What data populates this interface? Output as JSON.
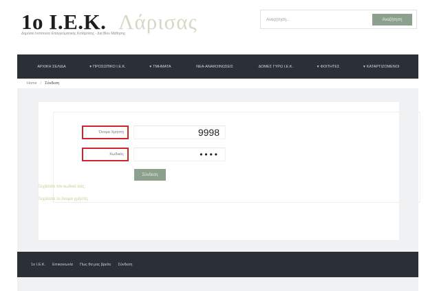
{
  "header": {
    "logo_main": "1ο Ι.Ε.Κ.",
    "logo_accent": "Λάρισας",
    "tagline": "Δημόσιο Ινστιτούτο Επαγγελματικής Κατάρτισης - Δια Βίου Μάθησης"
  },
  "search": {
    "placeholder": "Αναζήτηση...",
    "button_label": "Αναζήτηση"
  },
  "nav": {
    "items": [
      {
        "label": "ΑΡΧΙΚΗ ΣΕΛΙΔΑ",
        "arrow": ""
      },
      {
        "label": "ΠΡΟΣΩΠΙΚΟ Ι.Ε.Κ.",
        "arrow": "▾"
      },
      {
        "label": "ΤΜΗΜΑΤΑ",
        "arrow": "▾"
      },
      {
        "label": "ΝΕΑ-ΑΝΑΚΟΙΝΩΣΕΙΣ",
        "arrow": ""
      },
      {
        "label": "ΔΟΜΕΣ ΓΥΡΩ Ι.Ε.Κ.",
        "arrow": ""
      },
      {
        "label": "ΦΟΙΤΗΤΕΣ",
        "arrow": "▾"
      },
      {
        "label": "ΚΑΤΑΡΤΙΖΟΜΕΝΟΙ",
        "arrow": "▾"
      }
    ]
  },
  "breadcrumb": {
    "home": "Home",
    "separator": "/",
    "current": "Σύνδεση"
  },
  "login_form": {
    "username_label": "Όνομα Χρήστη",
    "username_value": "9998",
    "password_label": "Κωδικός",
    "password_mask": "••••",
    "submit_label": "Σύνδεση"
  },
  "links": {
    "forgot_password": "Ξεχάσατε τον κωδικό σας;",
    "new_code": "Ξεχάσατε το όνομα χρήστη;"
  },
  "footer": {
    "items": [
      "1ο Ι.Ε.Κ.",
      "Επικοινωνία",
      "Πως θα μας βρείτε",
      "Σύνδεση"
    ]
  },
  "colors": {
    "nav_bg": "#2a3036",
    "accent_green": "#8da08d",
    "error_border": "#cc2a2a",
    "link": "#c5cd95"
  }
}
